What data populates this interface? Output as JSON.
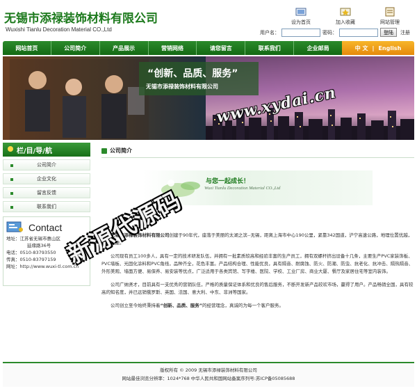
{
  "header": {
    "company_cn": "无锡市添禄装饰材料有限公司",
    "company_en": "Wuxishi Tianlu Decoration Material CO.,Ltd",
    "quick_links": [
      {
        "label": "设为首页",
        "icon": "home-icon"
      },
      {
        "label": "加入收藏",
        "icon": "favorite-icon"
      },
      {
        "label": "网站管理",
        "icon": "admin-icon"
      }
    ],
    "login": {
      "username_label": "用户名：",
      "username_value": "",
      "password_label": "密码：",
      "password_value": "",
      "submit_label": "登陆",
      "register_label": "注册"
    }
  },
  "nav": {
    "items": [
      "网站首页",
      "公司简介",
      "产品展示",
      "营销网络",
      "请您留言",
      "联系我们",
      "企业邮局"
    ],
    "lang_cn": "中 文",
    "lang_sep": "|",
    "lang_en": "English"
  },
  "banner": {
    "slogan": "“创新、品质、服务”",
    "company": "无锡市添禄装饰材料有限公司"
  },
  "sidebar": {
    "title": "栏/目/导/航",
    "items": [
      "公司简介",
      "企业文化",
      "留言反馈",
      "联系我们"
    ],
    "contact_title": "Contact",
    "contact_lines": [
      "地址：江苏省无锡市惠山区",
      "延缘路36号",
      "电话：0510-83793550",
      "传真：0510-83797159",
      "网址：http://www.wuxi-tl.com.cn"
    ]
  },
  "main": {
    "title": "公司简介",
    "hero_text": "与您一起成长！",
    "hero_sub": "Wuxi Tianlu Decoration Material CO.,Ltd",
    "para1_bold": "无锡市添禄装饰材料有限公司",
    "para1_rest": "创建于90年代，座落于美丽的太湖之滨--无锡，距离上海市中心190公里，紧靠342国道，沪宁高速公路，地理位置优越，交通便捷。",
    "para2": "公司现有员工100多人，具有一定的技术研发队伍，并拥有一批素质较高和经验丰富的生产员工，拥有双螺杆挤出设备十几条，主要生产PVC家装饰板、PVC墙板、光固化涂料和PVC角线，品种齐全，花色丰富。产品结构合理、性能优良，具有隔音、耐腐蚀、防火、防潮、防虫、抗老化、抗冲击、隔热隔音、外形美观、墙面方便、易保养、易安装等优点，广泛适用于各类宾馆、写字楼、医院、学校、工业厂房、商业大厦、餐厅及家居住宅等室内装饰。",
    "para3": "公司广纳贤才，目前具有一支优秀的营销队伍，严格的质量保证体系和优良的售后服务，不断开发新产品较欢市场，赢得了用户。产品畅销全国，具有较高的知名度，并已远销俄罗斯、英国、法国、意大利、中东、非洲等国家。",
    "para4_pre": "公司创立至今始终秉持着",
    "para4_bold": "“创新、品质、服务”",
    "para4_post": "的经营理念，真诚的为每一个客户服务。"
  },
  "watermarks": {
    "url": "www.xydai.cn",
    "name": "新源代源码"
  },
  "footer": {
    "line1": "版权所有 © 2009 无锡市添禄装饰材料有限公司",
    "line2": "网站最佳浏览分辨率：1024*768 中华人民共和国网站备案序列号:苏ICP备05085688"
  },
  "colors": {
    "brand_green": "#1d7a1d",
    "nav_green": "#2b8a2b",
    "lang_orange": "#f0a020"
  }
}
